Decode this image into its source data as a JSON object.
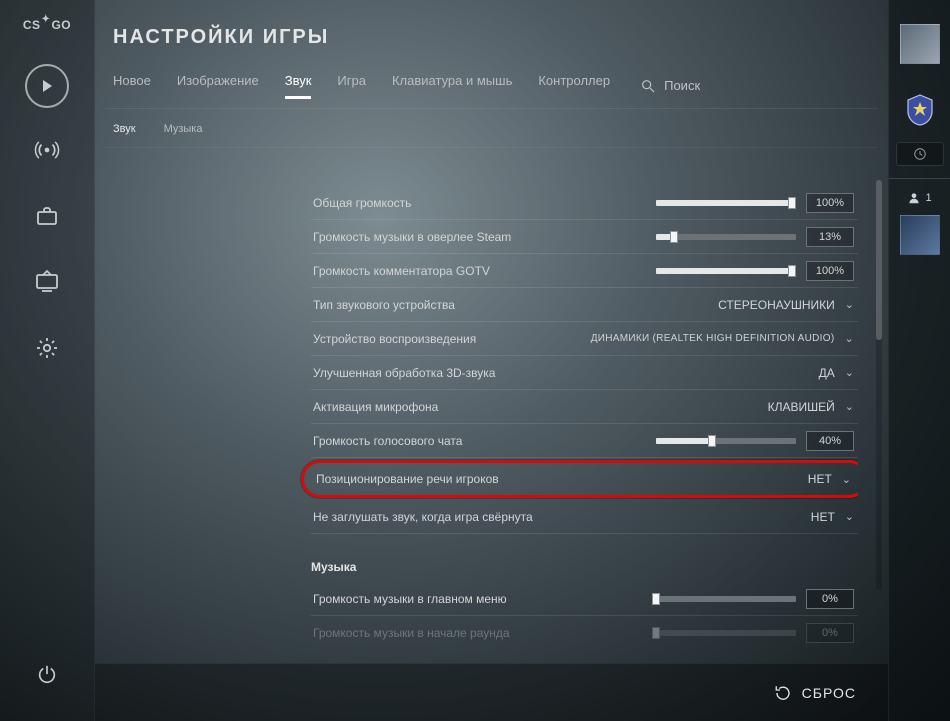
{
  "logo": {
    "left": "CS",
    "right": "GO"
  },
  "title": "НАСТРОЙКИ ИГРЫ",
  "tabs": [
    {
      "label": "Новое"
    },
    {
      "label": "Изображение"
    },
    {
      "label": "Звук",
      "active": true
    },
    {
      "label": "Игра"
    },
    {
      "label": "Клавиатура и мышь"
    },
    {
      "label": "Контроллер"
    }
  ],
  "search": {
    "label": "Поиск"
  },
  "subtabs": [
    {
      "label": "Звук",
      "active": true
    },
    {
      "label": "Музыка"
    }
  ],
  "rows": {
    "master_volume": {
      "label": "Общая громкость",
      "value": "100%",
      "pct": 100
    },
    "overlay_music": {
      "label": "Громкость музыки в оверлее Steam",
      "value": "13%",
      "pct": 13
    },
    "gotv_volume": {
      "label": "Громкость комментатора GOTV",
      "value": "100%",
      "pct": 100
    },
    "device_type": {
      "label": "Тип звукового устройства",
      "value": "СТЕРЕОНАУШНИКИ"
    },
    "playback_device": {
      "label": "Устройство воспроизведения",
      "value": "ДИНАМИКИ (REALTEK HIGH DEFINITION AUDIO)"
    },
    "hrtf": {
      "label": "Улучшенная обработка 3D-звука",
      "value": "ДА"
    },
    "mic_activation": {
      "label": "Активация микрофона",
      "value": "КЛАВИШЕЙ"
    },
    "voice_volume": {
      "label": "Громкость голосового чата",
      "value": "40%",
      "pct": 40
    },
    "voice_positional": {
      "label": "Позиционирование речи игроков",
      "value": "НЕТ"
    },
    "mute_bg": {
      "label": "Не заглушать звук, когда игра свёрнута",
      "value": "НЕТ"
    }
  },
  "music_section": {
    "title": "Музыка"
  },
  "music_rows": {
    "menu_music": {
      "label": "Громкость музыки в главном меню",
      "value": "0%",
      "pct": 0
    },
    "round_start_music": {
      "label": "Громкость музыки в начале раунда",
      "value": "0%",
      "pct": 0
    }
  },
  "footer": {
    "reset": "СБРОС"
  },
  "friends": {
    "count": "1"
  }
}
